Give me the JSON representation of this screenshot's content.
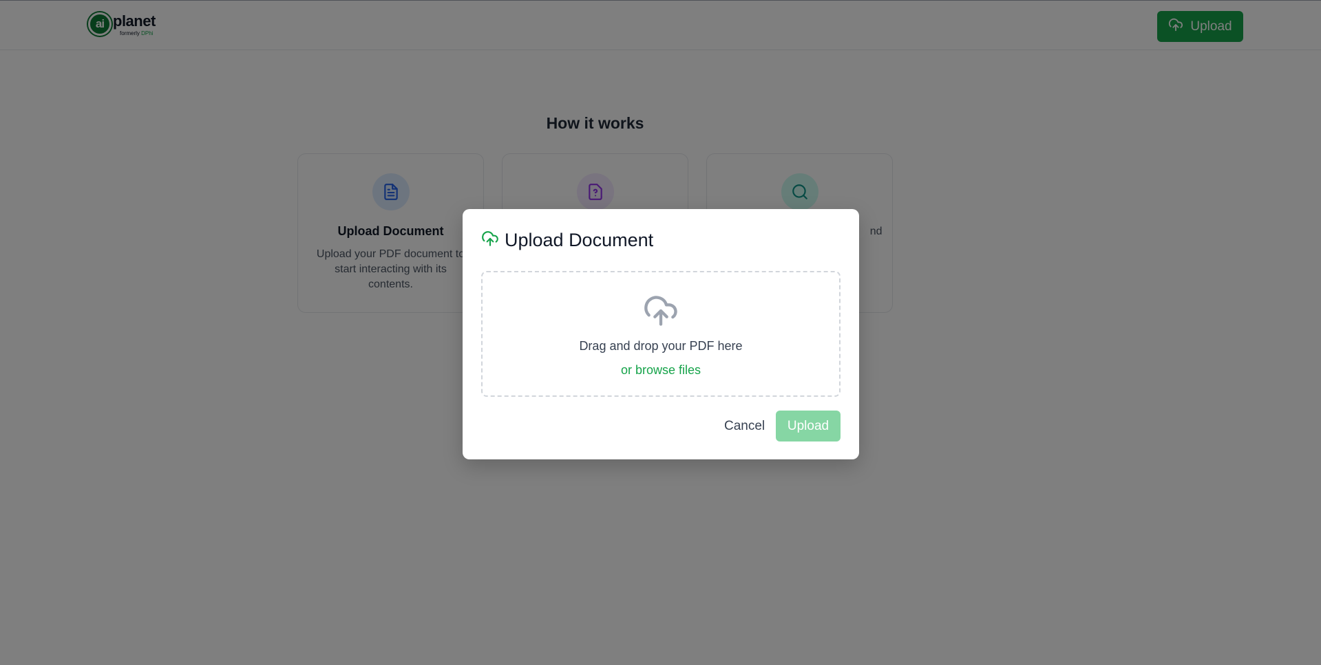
{
  "header": {
    "logo_mark": "ai",
    "logo_word": "planet",
    "logo_sub_prefix": "formerly",
    "logo_sub_brand": "DPhi",
    "upload_label": "Upload"
  },
  "how": {
    "title": "How it works",
    "cards": [
      {
        "icon": "document-icon",
        "title": "Upload Document",
        "desc": "Upload your PDF document to start interacting with its contents.",
        "icon_bg": "#dbeafe",
        "icon_color": "#2563eb"
      },
      {
        "icon": "question-file-icon",
        "title": "",
        "desc": "",
        "icon_bg": "#f3e8ff",
        "icon_color": "#9333ea"
      },
      {
        "icon": "search-icon",
        "title": "",
        "desc": "nd",
        "icon_bg": "#ccfbf1",
        "icon_color": "#0d9488"
      }
    ]
  },
  "modal": {
    "title": "Upload Document",
    "dropzone_text": "Drag and drop your PDF here",
    "browse_label": "or browse files",
    "cancel_label": "Cancel",
    "upload_label": "Upload"
  },
  "colors": {
    "brand_green": "#16a34a",
    "upload_disabled": "#86d6a4",
    "overlay": "rgba(0,0,0,0.5)"
  }
}
